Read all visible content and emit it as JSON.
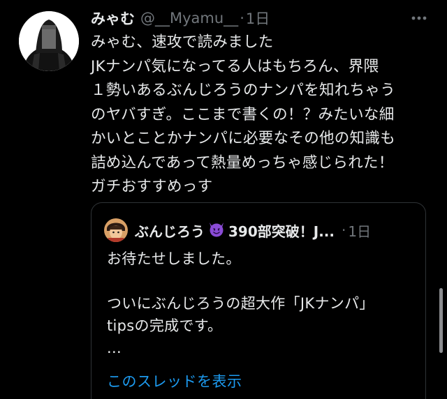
{
  "tweet": {
    "author": {
      "display_name": "みゃむ",
      "handle": "@__Myamu__",
      "avatar_icon": "hooded-figure-avatar"
    },
    "separator": "·",
    "time": "1日",
    "more_icon": "more-horizontal-icon",
    "text_lines": [
      "みゃむ、速攻で読みました",
      "JKナンパ気になってる人はもちろん、界隈",
      "１勢いあるぶんじろうのナンパを知れちゃう",
      "のヤバすぎ。ここまで書くの！？みたいな細",
      "かいとことかナンパに必要なその他の知識も",
      "詰め込んであって熱量めっちゃ感じられた！",
      "ガチおすすめっす"
    ]
  },
  "quote": {
    "author": {
      "name_prefix": "ぶんじろう",
      "emoji_icon": "smiling-devil-emoji",
      "name_suffix": "390部突破！J...",
      "avatar_icon": "anime-character-avatar"
    },
    "separator": "·",
    "time": "1日",
    "text_lines": [
      "お待たせしました。",
      "",
      "ついにぶんじろうの超大作「JKナンパ」",
      "tipsの完成です。",
      "..."
    ],
    "show_thread_label": "このスレッドを表示"
  },
  "colors": {
    "background": "#000000",
    "text": "#e7e9ea",
    "secondary": "#71767b",
    "link": "#1d9bf0",
    "border": "#2f3336",
    "devil": "#8a4bd6"
  }
}
